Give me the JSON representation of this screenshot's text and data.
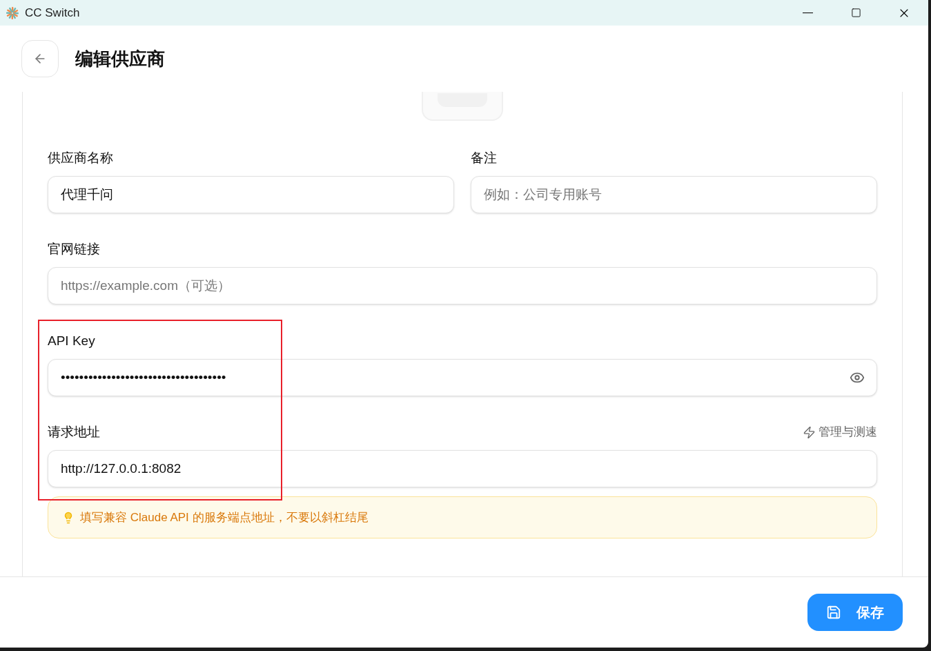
{
  "window": {
    "title": "CC Switch"
  },
  "header": {
    "title": "编辑供应商"
  },
  "form": {
    "row": [
      {
        "label": "供应商名称",
        "value": "代理千问"
      },
      {
        "label": "备注",
        "placeholder": "例如：公司专用账号"
      }
    ],
    "website": {
      "label": "官网链接",
      "placeholder": "https://example.com（可选）"
    },
    "api_key": {
      "label": "API Key",
      "value": "••••••••••••••••••••••••••••••••••••"
    },
    "endpoint": {
      "label": "请求地址",
      "action": "管理与测速",
      "value": "http://127.0.0.1:8082"
    },
    "hint": "填写兼容 Claude API 的服务端点地址，不要以斜杠结尾"
  },
  "footer": {
    "save": "保存"
  }
}
